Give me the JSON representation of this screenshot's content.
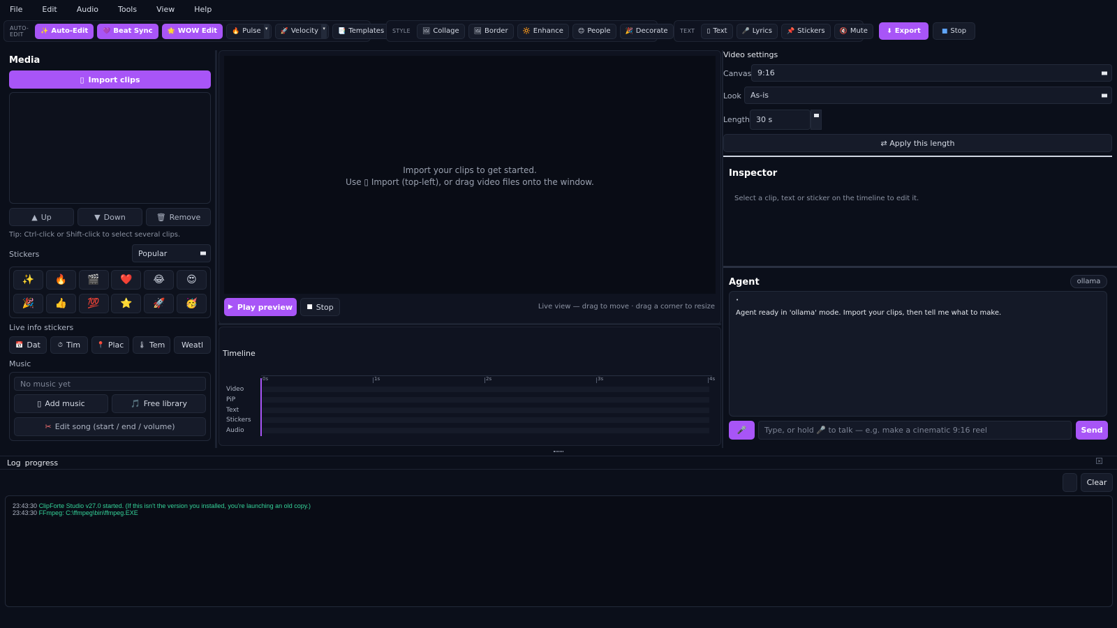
{
  "menubar": [
    "File",
    "Edit",
    "Audio",
    "Tools",
    "View",
    "Help"
  ],
  "toolbar": {
    "auto_edit": {
      "label": "AUTO-EDIT",
      "buttons": [
        {
          "icon": "sparkles-icon",
          "glyph": "✨",
          "label": "Auto-Edit"
        },
        {
          "icon": "beat-icon",
          "glyph": "💜",
          "label": "Beat Sync"
        },
        {
          "icon": "star-icon",
          "glyph": "🌟",
          "label": "WOW Edit"
        }
      ],
      "dropdowns": [
        {
          "glyph": "🔥",
          "label": "Pulse"
        },
        {
          "glyph": "🚀",
          "label": "Velocity"
        }
      ],
      "templates": {
        "glyph": "📑",
        "label": "Templates"
      }
    },
    "style": {
      "label": "STYLE",
      "buttons": [
        {
          "glyph": "🖼",
          "label": "Collage"
        },
        {
          "glyph": "🖼",
          "label": "Border"
        },
        {
          "glyph": "🔆",
          "label": "Enhance"
        },
        {
          "glyph": "😊",
          "label": "People"
        },
        {
          "glyph": "🎉",
          "label": "Decorate"
        }
      ]
    },
    "text": {
      "label": "TEXT",
      "buttons": [
        {
          "glyph": "▯",
          "label": "Text"
        },
        {
          "glyph": "🎤",
          "label": "Lyrics"
        },
        {
          "glyph": "📌",
          "label": "Stickers"
        },
        {
          "glyph": "🔇",
          "label": "Mute"
        }
      ]
    },
    "export_label": "Export",
    "stop_label": "Stop"
  },
  "media": {
    "title": "Media",
    "import_label": "Import clips",
    "up_label": "Up",
    "down_label": "Down",
    "remove_label": "Remove",
    "tip": "Tip: Ctrl-click or Shift-click to select several clips."
  },
  "stickers": {
    "label": "Stickers",
    "category": "Popular",
    "items": [
      "✨",
      "🔥",
      "🎬",
      "❤️",
      "😂",
      "😍",
      "🎉",
      "👍",
      "💯",
      "⭐",
      "🚀",
      "🥳"
    ]
  },
  "live_info": {
    "label": "Live info stickers",
    "items": [
      {
        "glyph": "📅",
        "label": "Dat"
      },
      {
        "glyph": "⏱",
        "label": "Tim"
      },
      {
        "glyph": "📍",
        "label": "Plac"
      },
      {
        "glyph": "🌡",
        "label": "Tem"
      },
      {
        "glyph": "",
        "label": "Weatl"
      }
    ]
  },
  "music": {
    "label": "Music",
    "placeholder": "No music yet",
    "add_label": "Add music",
    "library_label": "Free library",
    "edit_label": "Edit song (start / end / volume)"
  },
  "preview": {
    "empty_line1": "Import your clips to get started.",
    "empty_line2": "Use ▯ Import (top-left), or drag video files onto the window.",
    "play_label": "Play preview",
    "stop_label": "Stop",
    "hint": "Live view — drag to move · drag a corner to resize"
  },
  "timeline": {
    "title": "Timeline",
    "ticks": [
      "0s",
      "1s",
      "2s",
      "3s",
      "4s"
    ],
    "tracks": [
      "Video",
      "PiP",
      "Text",
      "Stickers",
      "Audio"
    ]
  },
  "video_settings": {
    "title": "Video settings",
    "canvas_label": "Canvas",
    "canvas_value": "9:16",
    "look_label": "Look",
    "look_value": "As-is",
    "length_label": "Length",
    "length_value": "30 s",
    "apply_label": "⇄ Apply this length"
  },
  "inspector": {
    "title": "Inspector",
    "hint": "Select a clip, text or sticker on the timeline to edit it."
  },
  "agent": {
    "title": "Agent",
    "mode_badge": "ollama",
    "bullet": "•",
    "message": "Agent ready in 'ollama' mode. Import your clips, then tell me what to make.",
    "input_placeholder": "Type, or hold 🎤 to talk — e.g. make a cinematic 9:16 reel",
    "send_label": "Send"
  },
  "log": {
    "tab_log": "Log",
    "tab_progress": "progress",
    "clear_label": "Clear",
    "lines": [
      {
        "time": "23:43:30",
        "text": "ClipForte Studio v27.0 started. (If this isn't the version you installed, you're launching an old copy.)"
      },
      {
        "time": "23:43:30",
        "text": "FFmpeg: C:\\ffmpeg\\bin\\ffmpeg.EXE"
      }
    ]
  },
  "colors": {
    "accent": "#a855f7",
    "background": "#0b0f1a",
    "log_text": "#34d399"
  }
}
